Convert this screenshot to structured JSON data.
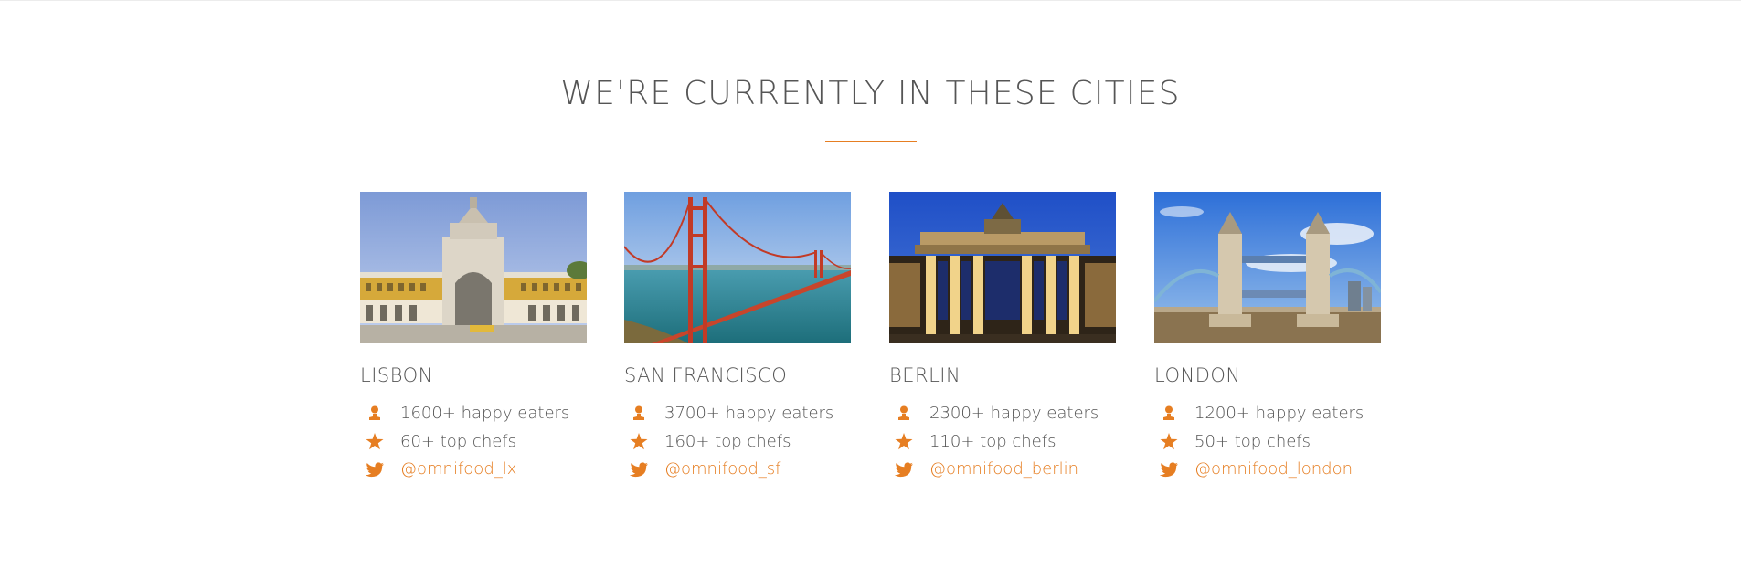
{
  "section": {
    "title": "WE'RE CURRENTLY IN THESE CITIES"
  },
  "colors": {
    "accent": "#e67e22",
    "text": "#555555"
  },
  "cities": [
    {
      "name": "LISBON",
      "photo": "lisbon-arch-photo",
      "eaters": "1600+ happy eaters",
      "chefs": "60+ top chefs",
      "twitter": "@omnifood_lx"
    },
    {
      "name": "SAN FRANCISCO",
      "photo": "golden-gate-bridge-photo",
      "eaters": "3700+ happy eaters",
      "chefs": "160+ top chefs",
      "twitter": "@omnifood_sf"
    },
    {
      "name": "BERLIN",
      "photo": "brandenburg-gate-photo",
      "eaters": "2300+ happy eaters",
      "chefs": "110+ top chefs",
      "twitter": "@omnifood_berlin"
    },
    {
      "name": "LONDON",
      "photo": "tower-bridge-photo",
      "eaters": "1200+ happy eaters",
      "chefs": "50+ top chefs",
      "twitter": "@omnifood_london"
    }
  ],
  "icons": {
    "eaters": "person-icon",
    "chefs": "star-icon",
    "twitter": "twitter-bird-icon"
  }
}
